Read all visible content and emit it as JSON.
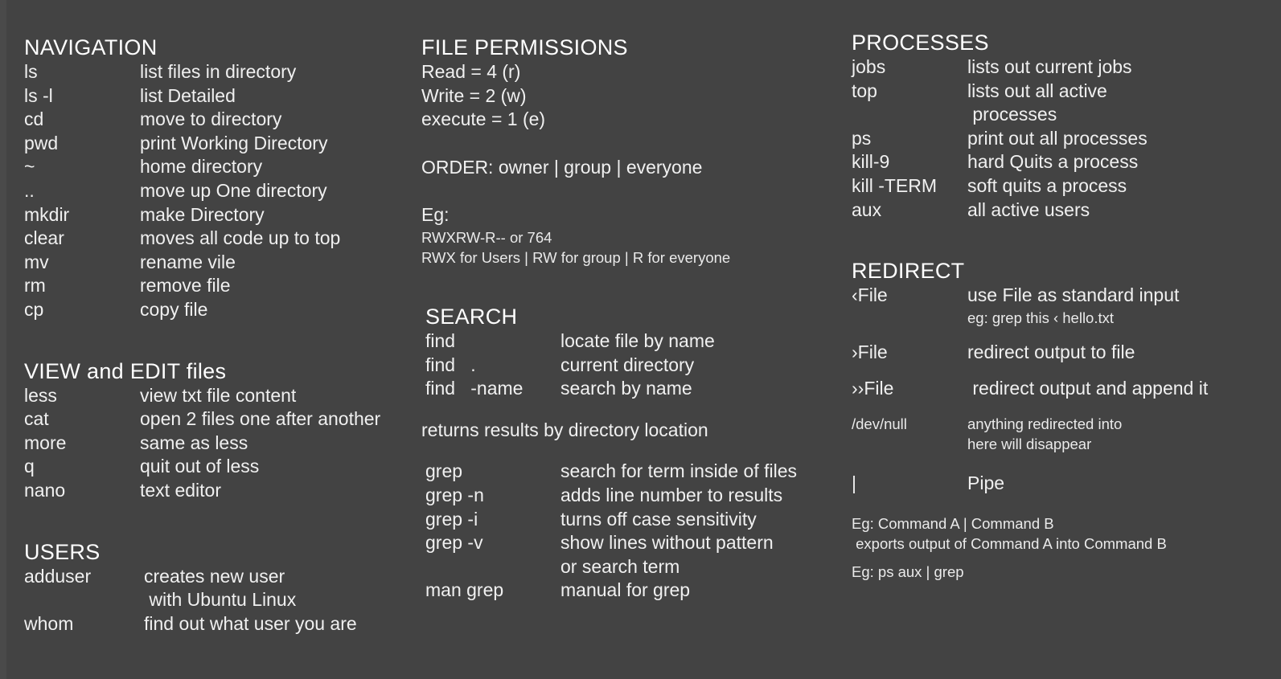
{
  "theme": {
    "background": "#434343",
    "text": "#f0f0f0",
    "heading": "#ffffff"
  },
  "columns": {
    "left": {
      "navigation": {
        "heading": "NAVIGATION",
        "rows": [
          {
            "cmd": "ls",
            "desc": "list files in directory"
          },
          {
            "cmd": "ls -l",
            "desc": "list Detailed"
          },
          {
            "cmd": "cd",
            "desc": "move to directory"
          },
          {
            "cmd": "pwd",
            "desc": "print Working Directory"
          },
          {
            "cmd": "~",
            "desc": "home directory"
          },
          {
            "cmd": "..",
            "desc": "move up One directory"
          },
          {
            "cmd": "mkdir",
            "desc": "make Directory"
          },
          {
            "cmd": "clear",
            "desc": "moves all code up to top"
          },
          {
            "cmd": "mv",
            "desc": "rename vile"
          },
          {
            "cmd": "rm",
            "desc": "remove file"
          },
          {
            "cmd": "cp",
            "desc": "copy file"
          }
        ]
      },
      "view_edit": {
        "heading": "VIEW and EDIT files",
        "rows": [
          {
            "cmd": "less",
            "desc": "view txt file content"
          },
          {
            "cmd": "cat",
            "desc": "open 2 files one after another"
          },
          {
            "cmd": "more",
            "desc": "same as less"
          },
          {
            "cmd": "q",
            "desc": "quit out of less"
          },
          {
            "cmd": "nano",
            "desc": "text editor"
          }
        ]
      },
      "users": {
        "heading": "USERS",
        "rows": [
          {
            "cmd": "adduser",
            "desc": "creates new user"
          },
          {
            "cmd": "",
            "desc": " with Ubuntu Linux"
          },
          {
            "cmd": "whom",
            "desc": "find out what user you are"
          }
        ]
      }
    },
    "middle": {
      "file_permissions": {
        "heading": "FILE PERMISSIONS",
        "lines": [
          "Read = 4 (r)",
          "Write = 2 (w)",
          "execute = 1 (e)"
        ],
        "order_line": "ORDER: owner | group | everyone",
        "example_label": "Eg:",
        "example_lines": [
          "RWXRW-R-- or 764",
          "RWX for Users | RW for group | R for everyone"
        ]
      },
      "search": {
        "heading": "SEARCH",
        "rows": [
          {
            "cmd": "find",
            "desc": "locate file by name"
          },
          {
            "cmd": "find   .",
            "desc": "current directory"
          },
          {
            "cmd": "find   -name",
            "desc": "search by name"
          }
        ],
        "note": "returns results by directory location",
        "grep_rows": [
          {
            "cmd": "grep",
            "desc": "search for term inside of files"
          },
          {
            "cmd": "grep -n",
            "desc": "adds line number to results"
          },
          {
            "cmd": "grep -i",
            "desc": "turns off case sensitivity"
          },
          {
            "cmd": "grep -v",
            "desc": "show lines without pattern"
          },
          {
            "cmd": "",
            "desc": "or search term"
          },
          {
            "cmd": "man grep",
            "desc": "manual for grep"
          }
        ]
      }
    },
    "right": {
      "processes": {
        "heading": "PROCESSES",
        "rows": [
          {
            "cmd": "jobs",
            "desc": "lists out current jobs"
          },
          {
            "cmd": "top",
            "desc": "lists out all active"
          },
          {
            "cmd": "",
            "desc": " processes"
          },
          {
            "cmd": "ps",
            "desc": "print out all processes"
          },
          {
            "cmd": "kill-9",
            "desc": "hard Quits a process"
          },
          {
            "cmd": "kill -TERM",
            "desc": "soft quits a process"
          },
          {
            "cmd": "aux",
            "desc": "all active users"
          }
        ]
      },
      "redirect": {
        "heading": "REDIRECT",
        "stdin": {
          "cmd": "‹File",
          "desc": "use File as standard input",
          "example": "eg: grep this ‹ hello.txt"
        },
        "stdout": {
          "cmd": "›File",
          "desc": "redirect output to file"
        },
        "append": {
          "cmd": "››File",
          "desc": " redirect output and append it"
        },
        "devnull": {
          "cmd": "/dev/null",
          "desc": "anything redirected into",
          "desc2": "here will disappear"
        },
        "pipe": {
          "cmd": "|",
          "desc": "Pipe"
        },
        "examples": [
          "Eg: Command A | Command B",
          " exports output of Command A into Command B",
          "Eg: ps aux | grep"
        ]
      }
    }
  }
}
